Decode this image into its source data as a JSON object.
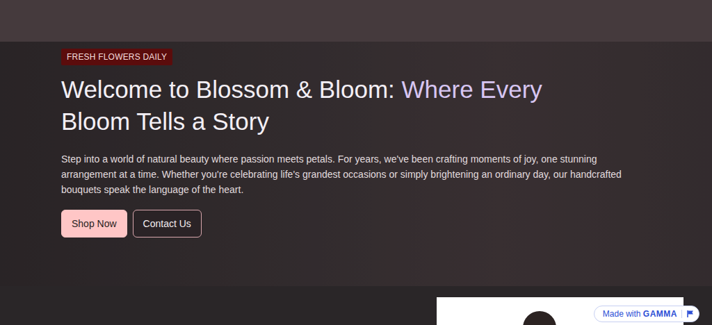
{
  "hero": {
    "badge": "FRESH FLOWERS DAILY",
    "title": [
      {
        "text": "Welcome to Blossom & Bloom: ",
        "accent": false
      },
      {
        "text": "Where Every",
        "accent": true
      },
      {
        "text": " Bloom Tells a Story",
        "accent": false
      }
    ],
    "intro": "Step into a world of natural beauty where passion meets petals. For years, we've been crafting moments of joy, one stunning arrangement at a time. Whether you're celebrating life's grandest occasions or simply brightening an ordinary day, our handcrafted bouquets speak the language of the heart.",
    "buttons": [
      {
        "label": "Shop Now",
        "kind": "primary"
      },
      {
        "label": "Contact Us",
        "kind": "secondary"
      }
    ]
  },
  "gamma_badge": {
    "made_with": "Made with",
    "brand": "GAMMA"
  }
}
